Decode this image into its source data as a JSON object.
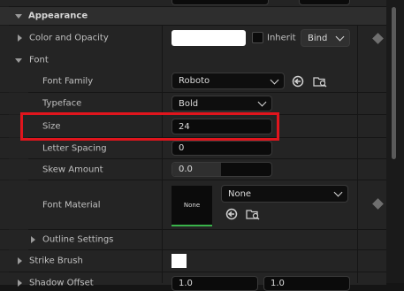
{
  "top_row": {
    "value1": "",
    "value2": ""
  },
  "appearance": {
    "label": "Appearance"
  },
  "color_opacity": {
    "label": "Color and Opacity",
    "inherit_label": "Inherit",
    "bind_label": "Bind",
    "swatch_color": "#ffffff"
  },
  "font": {
    "label": "Font",
    "family": {
      "label": "Font Family",
      "value": "Roboto"
    },
    "typeface": {
      "label": "Typeface",
      "value": "Bold"
    },
    "size": {
      "label": "Size",
      "value": "24"
    },
    "letter_spacing": {
      "label": "Letter Spacing",
      "value": "0"
    },
    "skew": {
      "label": "Skew Amount",
      "value": "0.0"
    },
    "material": {
      "label": "Font Material",
      "thumb_label": "None",
      "value": "None"
    },
    "outline": {
      "label": "Outline Settings"
    }
  },
  "strike_brush": {
    "label": "Strike Brush",
    "swatch_color": "#ffffff"
  },
  "shadow_offset": {
    "label": "Shadow Offset",
    "x": "1.0",
    "y": "1.0"
  },
  "colors": {
    "highlight": "#e0151d",
    "accent_green": "#39b34a",
    "panel": "#242424",
    "row_alt": "#1c1c1c"
  }
}
